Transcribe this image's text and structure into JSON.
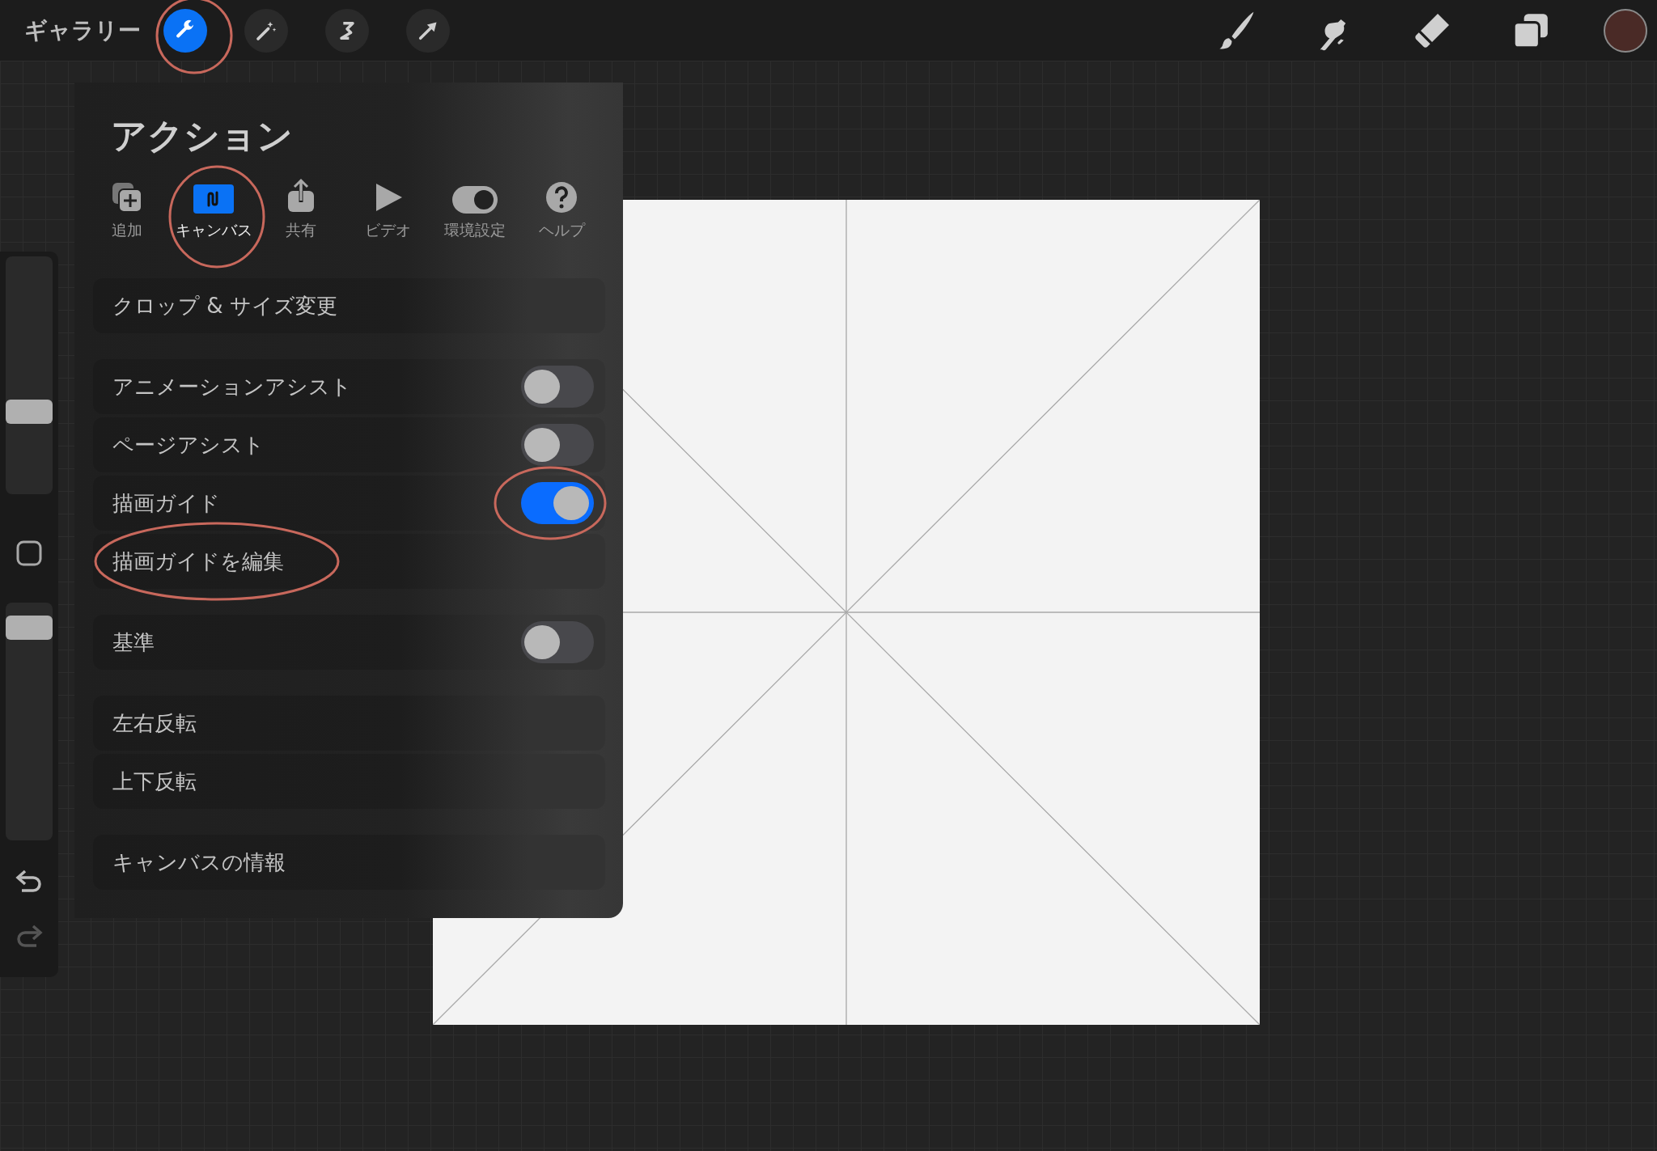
{
  "top_bar": {
    "gallery": "ギャラリー",
    "left_tools": [
      {
        "kind": "wrench",
        "selected": true
      },
      {
        "kind": "wand",
        "selected": false
      },
      {
        "kind": "selection",
        "selected": false
      },
      {
        "kind": "arrow",
        "selected": false
      }
    ],
    "right_tools": [
      {
        "kind": "brush"
      },
      {
        "kind": "smudge"
      },
      {
        "kind": "eraser"
      },
      {
        "kind": "layers"
      }
    ],
    "color_swatch": {
      "color": "#4a2a26"
    }
  },
  "sidebar": {
    "sliders": [
      {
        "level": 0.33
      },
      {
        "level": 0.94
      }
    ]
  },
  "actions_panel": {
    "title": "アクション",
    "tabs": [
      {
        "kind": "add",
        "label": "追加",
        "selected": false
      },
      {
        "kind": "canvas",
        "label": "キャンバス",
        "selected": true
      },
      {
        "kind": "share",
        "label": "共有",
        "selected": false
      },
      {
        "kind": "video",
        "label": "ビデオ",
        "selected": false
      },
      {
        "kind": "prefs",
        "label": "環境設定",
        "selected": false
      },
      {
        "kind": "help",
        "label": "ヘルプ",
        "selected": false
      }
    ],
    "groups": [
      [
        {
          "kind": "plain",
          "label": "クロップ & サイズ変更"
        }
      ],
      [
        {
          "kind": "toggle",
          "label": "アニメーションアシスト",
          "on": false
        },
        {
          "kind": "toggle",
          "label": "ページアシスト",
          "on": false
        },
        {
          "kind": "toggle",
          "label": "描画ガイド",
          "on": true
        },
        {
          "kind": "plain",
          "label": "描画ガイドを編集"
        }
      ],
      [
        {
          "kind": "toggle",
          "label": "基準",
          "on": false
        }
      ],
      [
        {
          "kind": "plain",
          "label": "左右反転"
        },
        {
          "kind": "plain",
          "label": "上下反転"
        }
      ],
      [
        {
          "kind": "plain",
          "label": "キャンバスの情報"
        }
      ]
    ]
  }
}
